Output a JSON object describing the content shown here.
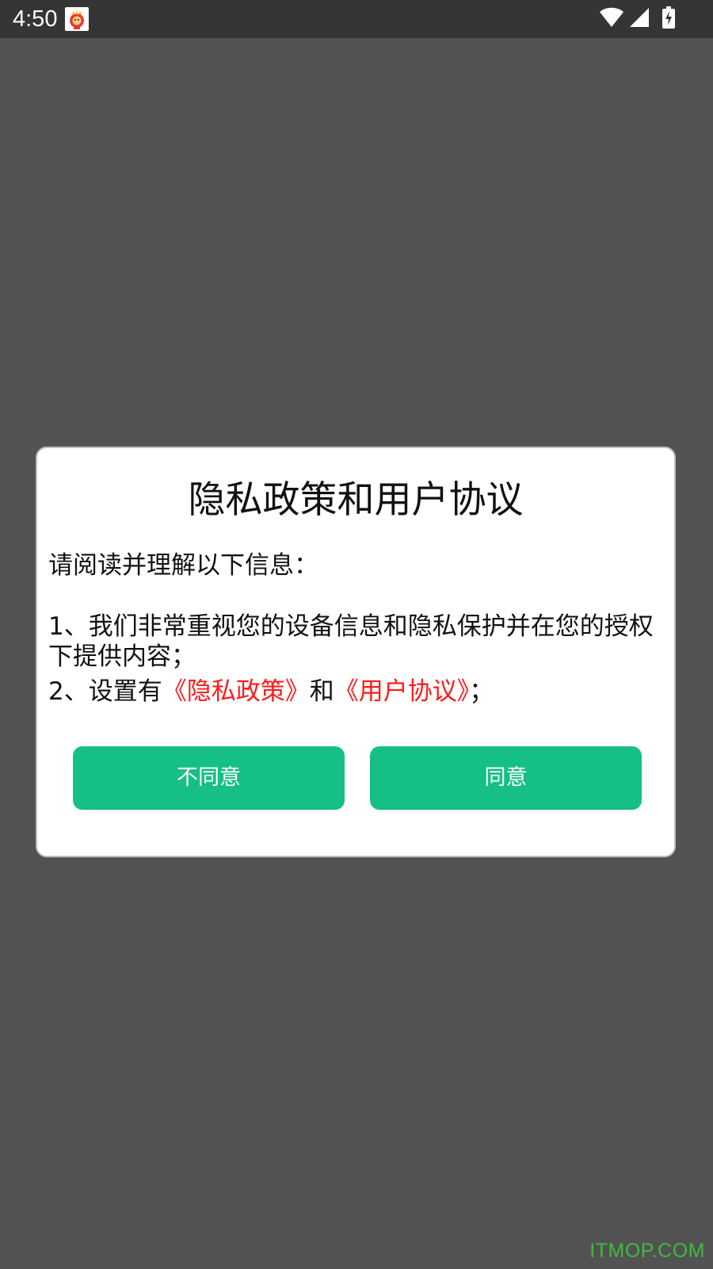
{
  "status_bar": {
    "time": "4:50",
    "app_icon": "app-mascot-icon",
    "icons": [
      "wifi-icon",
      "signal-icon",
      "battery-charging-icon"
    ]
  },
  "dialog": {
    "title": "隐私政策和用户协议",
    "intro": "请阅读并理解以下信息：",
    "item1": "1、我们非常重视您的设备信息和隐私保护并在您的授权下提供内容；",
    "item2": {
      "prefix": "2、设置有",
      "privacy_link": "《隐私政策》",
      "middle": "和",
      "agreement_link": "《用户协议》",
      "suffix": "；"
    },
    "disagree_label": "不同意",
    "agree_label": "同意"
  },
  "watermark": "ITMOP.COM",
  "colors": {
    "overlay": "#525252",
    "status_bar": "#353535",
    "button": "#16bf85",
    "link": "#ff1a1a",
    "watermark": "#3dbd3d"
  }
}
